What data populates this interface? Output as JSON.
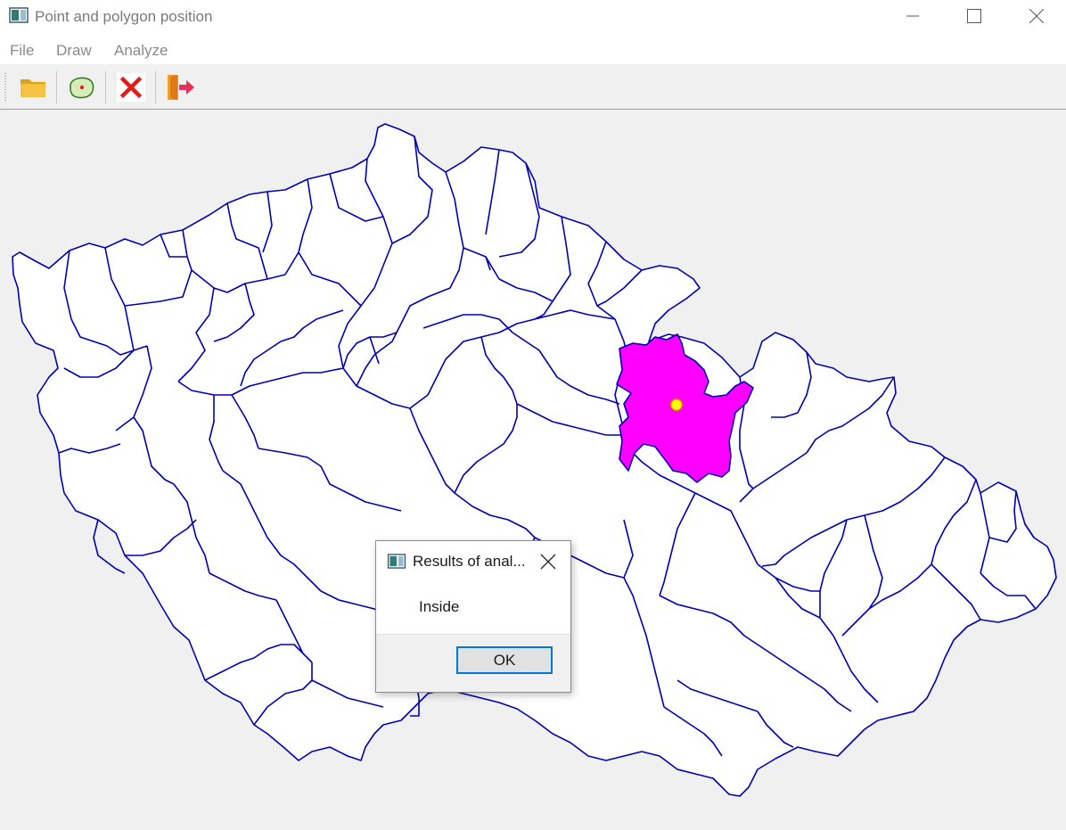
{
  "window": {
    "title": "Point and polygon position"
  },
  "menu": {
    "items": [
      "File",
      "Draw",
      "Analyze"
    ]
  },
  "toolbar": {
    "buttons": [
      {
        "icon": "folder-open-icon",
        "tooltip": ""
      },
      {
        "icon": "point-in-polygon-icon",
        "tooltip": ""
      },
      {
        "icon": "clear-icon",
        "tooltip": ""
      },
      {
        "icon": "exit-icon",
        "tooltip": ""
      }
    ]
  },
  "map": {
    "border_color": "#0000b4",
    "highlight_color": "#ff00ff",
    "point_color": "#ffff00"
  },
  "dialog": {
    "title": "Results of anal...",
    "message": "Inside",
    "ok_label": "OK"
  }
}
